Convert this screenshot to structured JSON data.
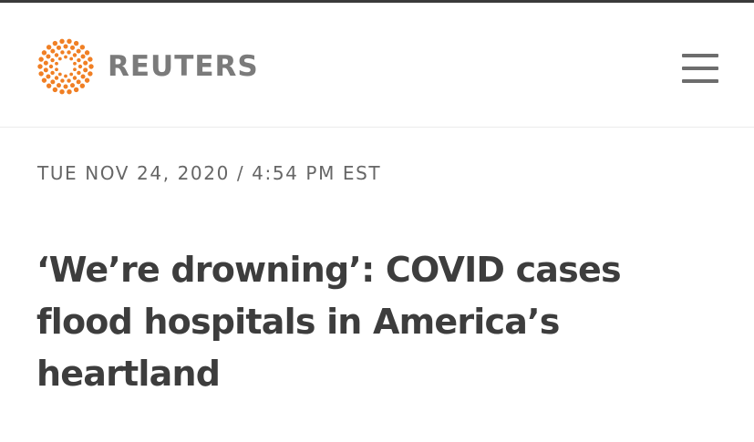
{
  "header": {
    "brand": "REUTERS",
    "logo_icon": "reuters-dot-circle-logo",
    "logo_color": "#f07f24",
    "menu_icon": "hamburger-menu-icon"
  },
  "article": {
    "dateline": "TUE NOV 24, 2020 / 4:54 PM EST",
    "headline": "‘We’re drowning’: COVID cases flood hospitals in America’s heartland"
  }
}
